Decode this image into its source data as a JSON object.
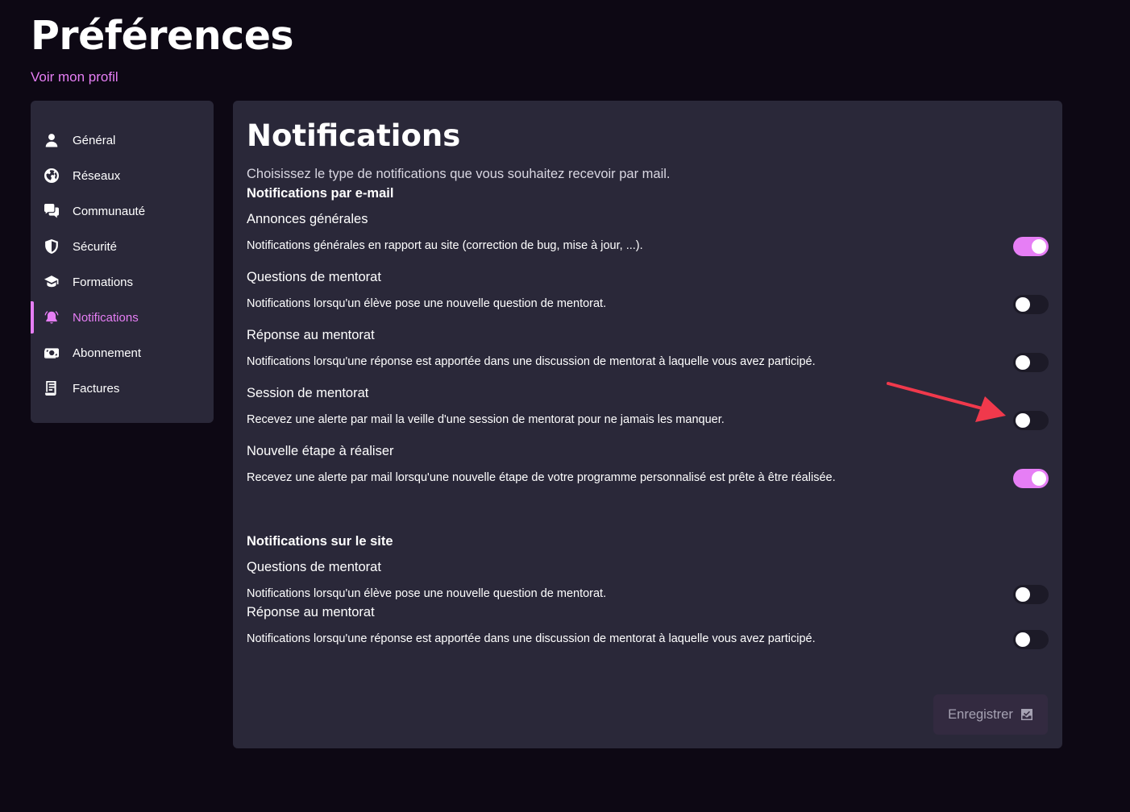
{
  "page": {
    "title": "Préférences",
    "profile_link": "Voir mon profil"
  },
  "sidebar": {
    "items": [
      {
        "label": "Général",
        "icon": "user-icon"
      },
      {
        "label": "Réseaux",
        "icon": "globe-icon"
      },
      {
        "label": "Communauté",
        "icon": "chat-icon"
      },
      {
        "label": "Sécurité",
        "icon": "shield-icon"
      },
      {
        "label": "Formations",
        "icon": "graduation-cap-icon"
      },
      {
        "label": "Notifications",
        "icon": "bell-icon",
        "active": true
      },
      {
        "label": "Abonnement",
        "icon": "money-icon"
      },
      {
        "label": "Factures",
        "icon": "receipt-icon"
      }
    ]
  },
  "panel": {
    "title": "Notifications",
    "description": "Choisissez le type de notifications que vous souhaitez recevoir par mail.",
    "email_section": {
      "title": "Notifications par e-mail",
      "settings": [
        {
          "title": "Annonces générales",
          "desc": "Notifications générales en rapport au site (correction de bug, mise à jour, ...).",
          "enabled": true
        },
        {
          "title": "Questions de mentorat",
          "desc": "Notifications lorsqu'un élève pose une nouvelle question de mentorat.",
          "enabled": false
        },
        {
          "title": "Réponse au mentorat",
          "desc": "Notifications lorsqu'une réponse est apportée dans une discussion de mentorat à laquelle vous avez participé.",
          "enabled": false
        },
        {
          "title": "Session de mentorat",
          "desc": "Recevez une alerte par mail la veille d'une session de mentorat pour ne jamais les manquer.",
          "enabled": false
        },
        {
          "title": "Nouvelle étape à réaliser",
          "desc": "Recevez une alerte par mail lorsqu'une nouvelle étape de votre programme personnalisé est prête à être réalisée.",
          "enabled": true
        }
      ]
    },
    "site_section": {
      "title": "Notifications sur le site",
      "settings": [
        {
          "title": "Questions de mentorat",
          "desc": "Notifications lorsqu'un élève pose une nouvelle question de mentorat.",
          "enabled": false
        },
        {
          "title": "Réponse au mentorat",
          "desc": "Notifications lorsqu'une réponse est apportée dans une discussion de mentorat à laquelle vous avez participé.",
          "enabled": false
        }
      ]
    },
    "save_label": "Enregistrer",
    "save_icon": "save-icon"
  },
  "colors": {
    "background": "#0d0814",
    "panel": "#2a2839",
    "accent": "#e67ef5",
    "annotation_arrow": "#f0394c"
  }
}
